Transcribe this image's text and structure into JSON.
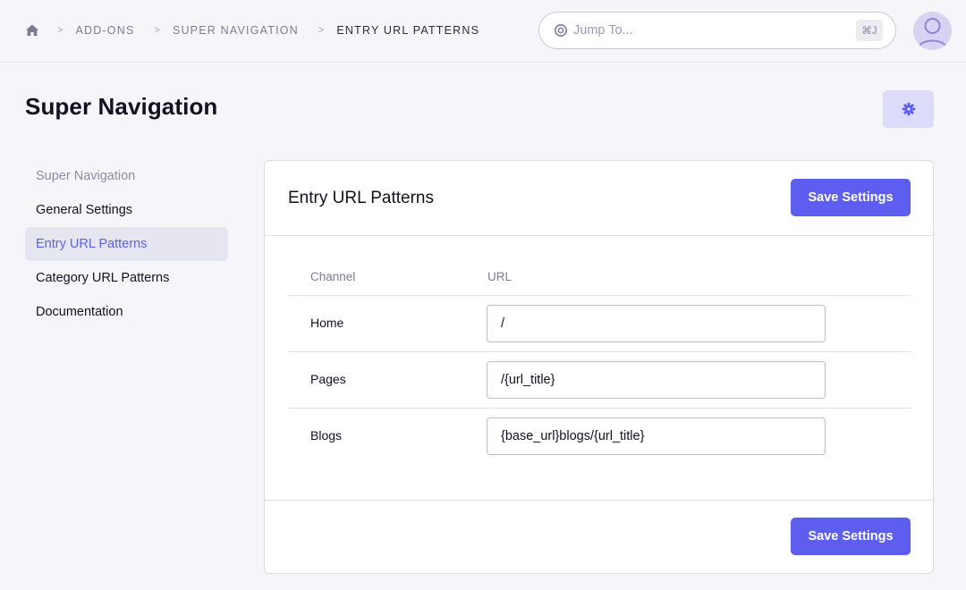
{
  "breadcrumb": {
    "separator": ">",
    "items": [
      "ADD-ONS",
      "SUPER NAVIGATION"
    ],
    "current": "ENTRY URL PATTERNS"
  },
  "search": {
    "placeholder": "Jump To...",
    "shortcut": "⌘J"
  },
  "page": {
    "title": "Super Navigation"
  },
  "sidebar": {
    "heading": "Super Navigation",
    "items": [
      {
        "label": "General Settings",
        "active": false
      },
      {
        "label": "Entry URL Patterns",
        "active": true
      },
      {
        "label": "Category URL Patterns",
        "active": false
      },
      {
        "label": "Documentation",
        "active": false
      }
    ]
  },
  "panel": {
    "title": "Entry URL Patterns",
    "save_label": "Save Settings",
    "table": {
      "headers": {
        "channel": "Channel",
        "url": "URL"
      },
      "rows": [
        {
          "channel": "Home",
          "url": "/"
        },
        {
          "channel": "Pages",
          "url": "/{url_title}"
        },
        {
          "channel": "Blogs",
          "url": "{base_url}blogs/{url_title}"
        }
      ]
    }
  },
  "colors": {
    "accent": "#5d5ef0",
    "active_text": "#5d63e8",
    "active_bg": "#e6e6f0",
    "background": "#f6f6fa"
  },
  "icons": {
    "home": "home-icon",
    "search": "target-icon",
    "settings": "gear-icon",
    "avatar": "user-avatar-icon"
  }
}
